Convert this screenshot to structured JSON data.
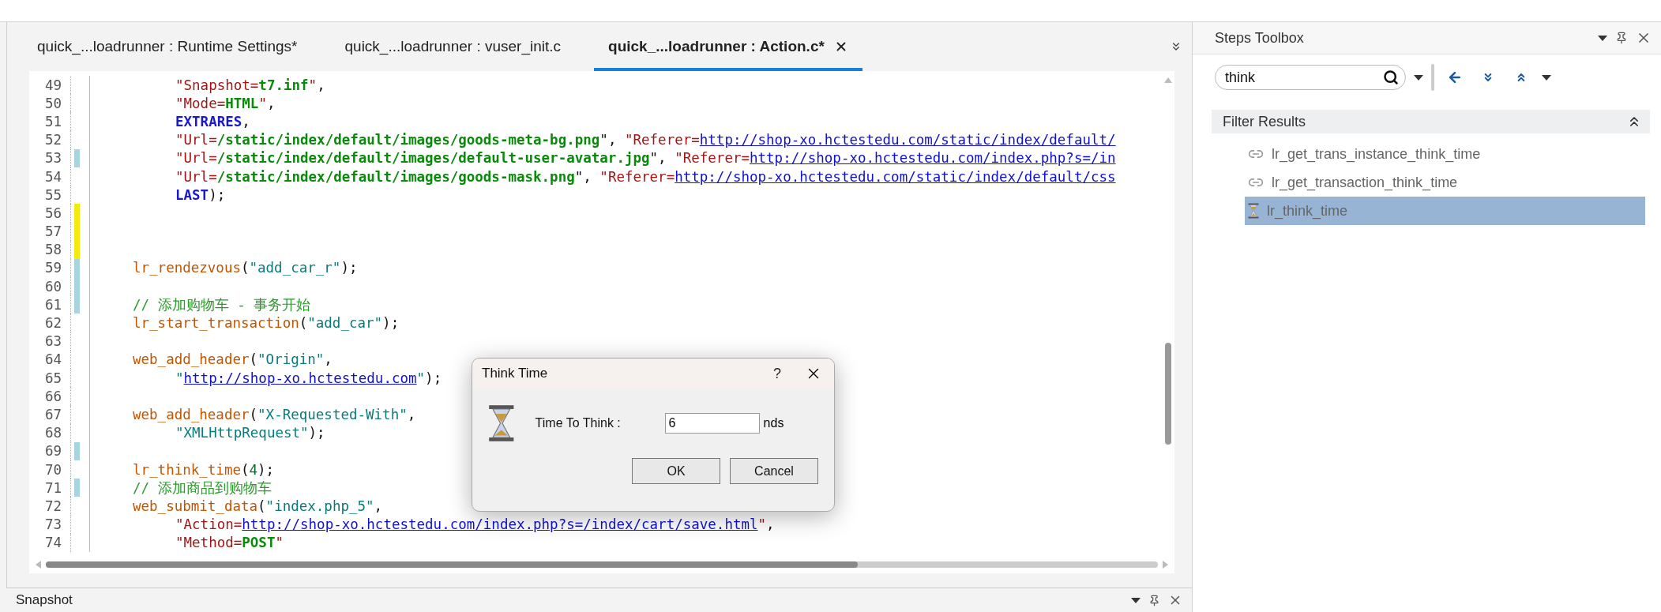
{
  "tabs": [
    {
      "label": "quick_...loadrunner : Runtime Settings*",
      "selected": false
    },
    {
      "label": "quick_...loadrunner : vuser_init.c",
      "selected": false
    },
    {
      "label": "quick_...loadrunner : Action.c*",
      "selected": true
    }
  ],
  "code": [
    {
      "num": "49",
      "kind": "continuation",
      "tokens": [
        {
          "kind": "key",
          "t": "\"Snapshot="
        },
        {
          "kind": "val",
          "t": "t7.inf"
        },
        {
          "kind": "key",
          "t": "\""
        },
        {
          "kind": "plain",
          "t": ","
        }
      ]
    },
    {
      "num": "50",
      "kind": "continuation",
      "tokens": [
        {
          "kind": "key",
          "t": "\"Mode="
        },
        {
          "kind": "val",
          "t": "HTML"
        },
        {
          "kind": "key",
          "t": "\""
        },
        {
          "kind": "plain",
          "t": ","
        }
      ]
    },
    {
      "num": "51",
      "kind": "continuation",
      "tokens": [
        {
          "kind": "kw",
          "t": "EXTRARES"
        },
        {
          "kind": "plain",
          "t": ","
        }
      ]
    },
    {
      "num": "52",
      "kind": "continuation",
      "tokens": [
        {
          "kind": "key",
          "t": "\"Url="
        },
        {
          "kind": "val",
          "t": "/static/index/default/images/goods-meta-bg.png"
        },
        {
          "kind": "plain",
          "t": "\", "
        },
        {
          "kind": "key",
          "t": "\"Referer="
        },
        {
          "kind": "link",
          "t": "http://shop-xo.hctestedu.com/static/index/default/"
        }
      ]
    },
    {
      "num": "53",
      "color": "#a8d4e0",
      "kind": "continuation",
      "tokens": [
        {
          "kind": "key",
          "t": "\"Url="
        },
        {
          "kind": "val",
          "t": "/static/index/default/images/default-user-avatar.jpg"
        },
        {
          "kind": "plain",
          "t": "\", "
        },
        {
          "kind": "key",
          "t": "\"Referer="
        },
        {
          "kind": "link",
          "t": "http://shop-xo.hctestedu.com/index.php?s=/in"
        }
      ]
    },
    {
      "num": "54",
      "kind": "continuation",
      "tokens": [
        {
          "kind": "key",
          "t": "\"Url="
        },
        {
          "kind": "val",
          "t": "/static/index/default/images/goods-mask.png"
        },
        {
          "kind": "plain",
          "t": "\", "
        },
        {
          "kind": "key",
          "t": "\"Referer="
        },
        {
          "kind": "link",
          "t": "http://shop-xo.hctestedu.com/static/index/default/css"
        }
      ]
    },
    {
      "num": "55",
      "kind": "continuation",
      "tokens": [
        {
          "kind": "kw",
          "t": "LAST"
        },
        {
          "kind": "plain",
          "t": ");"
        }
      ]
    },
    {
      "num": "56",
      "color": "#f4ea10"
    },
    {
      "num": "57",
      "color": "#f4ea10"
    },
    {
      "num": "58",
      "color": "#f4ea10"
    },
    {
      "num": "59",
      "color": "#a8d4e0",
      "kind": "statement",
      "tokens": [
        {
          "kind": "fn",
          "t": "lr_rendezvous"
        },
        {
          "kind": "plain",
          "t": "("
        },
        {
          "kind": "str",
          "t": "\"add_car_r\""
        },
        {
          "kind": "plain",
          "t": ");"
        }
      ]
    },
    {
      "num": "60",
      "color": "#a8d4e0"
    },
    {
      "num": "61",
      "color": "#a8d4e0",
      "kind": "statement",
      "tokens": [
        {
          "kind": "comment",
          "t": "// 添加购物车 - 事务开始"
        }
      ]
    },
    {
      "num": "62",
      "kind": "statement",
      "tokens": [
        {
          "kind": "fn",
          "t": "lr_start_transaction"
        },
        {
          "kind": "plain",
          "t": "("
        },
        {
          "kind": "str",
          "t": "\"add_car\""
        },
        {
          "kind": "plain",
          "t": ");"
        }
      ]
    },
    {
      "num": "63"
    },
    {
      "num": "64",
      "kind": "statement",
      "tokens": [
        {
          "kind": "fn",
          "t": "web_add_header"
        },
        {
          "kind": "plain",
          "t": "("
        },
        {
          "kind": "str",
          "t": "\"Origin\""
        },
        {
          "kind": "plain",
          "t": ","
        }
      ]
    },
    {
      "num": "65",
      "kind": "continuation",
      "tokens": [
        {
          "kind": "str",
          "t": "\""
        },
        {
          "kind": "link",
          "t": "http://shop-xo.hctestedu.com"
        },
        {
          "kind": "str",
          "t": "\""
        },
        {
          "kind": "plain",
          "t": ");"
        }
      ]
    },
    {
      "num": "66"
    },
    {
      "num": "67",
      "kind": "statement",
      "tokens": [
        {
          "kind": "fn",
          "t": "web_add_header"
        },
        {
          "kind": "plain",
          "t": "("
        },
        {
          "kind": "str",
          "t": "\"X-Requested-With\""
        },
        {
          "kind": "plain",
          "t": ","
        }
      ]
    },
    {
      "num": "68",
      "kind": "continuation",
      "tokens": [
        {
          "kind": "str",
          "t": "\"XMLHttpRequest\""
        },
        {
          "kind": "plain",
          "t": ");"
        }
      ]
    },
    {
      "num": "69",
      "color": "#a8d4e0"
    },
    {
      "num": "70",
      "kind": "statement",
      "tokens": [
        {
          "kind": "fn",
          "t": "lr_think_time"
        },
        {
          "kind": "plain",
          "t": "("
        },
        {
          "kind": "num",
          "t": "4"
        },
        {
          "kind": "plain",
          "t": ");"
        }
      ]
    },
    {
      "num": "71",
      "color": "#a8d4e0",
      "kind": "statement",
      "tokens": [
        {
          "kind": "comment",
          "t": "// 添加商品到购物车"
        }
      ]
    },
    {
      "num": "72",
      "kind": "statement",
      "tokens": [
        {
          "kind": "fn",
          "t": "web_submit_data"
        },
        {
          "kind": "plain",
          "t": "("
        },
        {
          "kind": "str",
          "t": "\"index.php_5\""
        },
        {
          "kind": "plain",
          "t": ","
        }
      ]
    },
    {
      "num": "73",
      "kind": "continuation",
      "tokens": [
        {
          "kind": "key",
          "t": "\"Action="
        },
        {
          "kind": "link",
          "t": "http://shop-xo.hctestedu.com/index.php?s=/index/cart/save.html"
        },
        {
          "kind": "key",
          "t": "\""
        },
        {
          "kind": "plain",
          "t": ","
        }
      ]
    },
    {
      "num": "74",
      "kind": "continuation",
      "tokens": [
        {
          "kind": "key",
          "t": "\"Method="
        },
        {
          "kind": "val",
          "t": "POST"
        },
        {
          "kind": "key",
          "t": "\""
        }
      ]
    }
  ],
  "dialog": {
    "title": "Think Time",
    "help": "?",
    "label": "Time To Think :",
    "value": "6",
    "unit": "nds",
    "buttons": [
      "OK",
      "Cancel"
    ]
  },
  "toolbox": {
    "title": "Steps Toolbox",
    "search": "think",
    "section": "Filter Results",
    "items": [
      {
        "label": "lr_get_trans_instance_think_time",
        "kind": "step",
        "selected": false
      },
      {
        "label": "lr_get_transaction_think_time",
        "kind": "step",
        "selected": false
      },
      {
        "label": "lr_think_time",
        "kind": "think",
        "selected": true
      }
    ]
  },
  "snapshot": {
    "title": "Snapshot"
  }
}
